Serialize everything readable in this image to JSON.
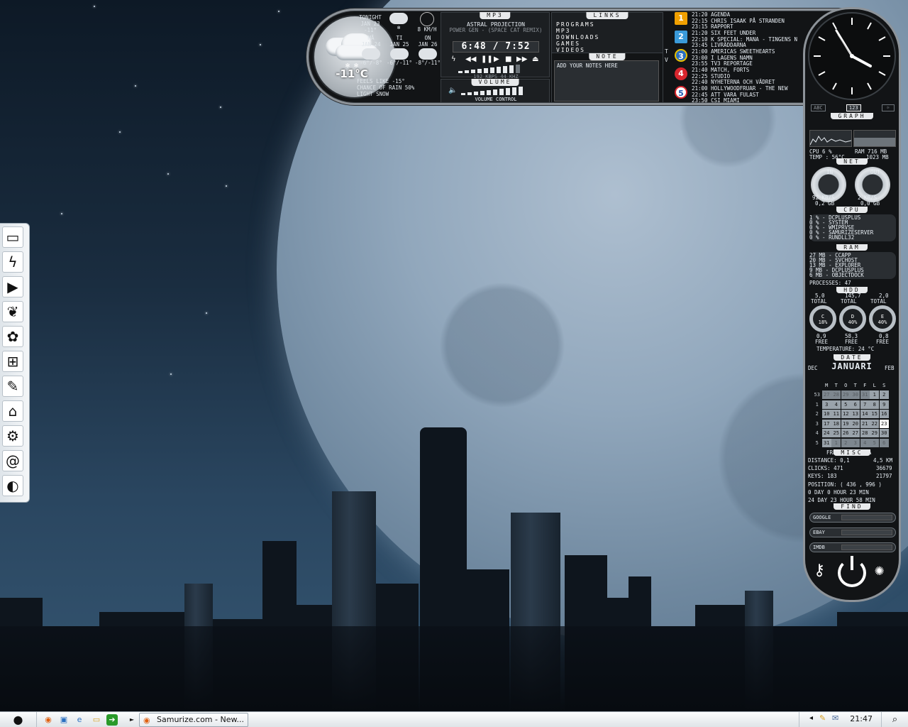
{
  "weather": {
    "current_temp": "-11°C",
    "tonight": {
      "label": "TONIGHT",
      "date": "JAN 23",
      "temp": "-11°"
    },
    "wind": "8 KM/H",
    "forecast": [
      {
        "day": "MÅ",
        "date": "JAN 24",
        "range": "-6°/-8°"
      },
      {
        "day": "TI",
        "date": "JAN 25",
        "range": "-6°/-11°"
      },
      {
        "day": "ON",
        "date": "JAN 26",
        "range": "-8°/-11°"
      }
    ],
    "feels_like": "FEELS LIKE -15°",
    "chance_rain": "CHANCE OF RAIN 50%",
    "condition": "LIGHT SNOW"
  },
  "mp3": {
    "title": "MP3",
    "artist": "ASTRAL PROJECTION",
    "track": "POWER GEN - (SPACE CAT REMIX)",
    "time": "6:48 / 7:52",
    "bitrate": "192 KBPS 44 KHZ",
    "volume_title": "VOLUME",
    "volume_label": "VOLUME CONTROL"
  },
  "links": {
    "title": "LINKS",
    "items": [
      "PROGRAMS",
      "MP3",
      "DOWNLOADS",
      "GAMES",
      "VIDEOS"
    ]
  },
  "note": {
    "title": "NOTE",
    "placeholder": "ADD YOUR NOTES HERE"
  },
  "tv": {
    "side_label": "T V",
    "channels": [
      {
        "num": "1",
        "lines": [
          "21:20 AGENDA",
          "22:15 CHRIS ISAAK PÅ STRANDEN",
          "23:15 RAPPORT"
        ],
        "color": "#f0a000"
      },
      {
        "num": "2",
        "lines": [
          "21:20 SIX FEET UNDER",
          "22:10 K SPECIAL: MANA - TINGENS N",
          "23:45 LIVRÄDDARNA"
        ],
        "color": "#3a9ad9"
      },
      {
        "num": "3",
        "lines": [
          "21:00 AMERICAS SWEETHEARTS",
          "23:00 I LAGENS NAMN",
          "23:55 TV3 REPORTAGE"
        ],
        "color": "#2a6fc0"
      },
      {
        "num": "4",
        "lines": [
          "21:40 MATCH, FORTS",
          "22:25 STUDIO",
          "22:40 NYHETERNA OCH VÄDRET"
        ],
        "color": "#d8262e"
      },
      {
        "num": "5",
        "lines": [
          "21:00 HOLLYWOODFRUAR - THE NEW",
          "22:45 ATT VARA FULAST",
          "23:50 CSI MIAMI"
        ],
        "color": "#1e5ab4"
      }
    ]
  },
  "clock": {
    "tabs": [
      "ABC",
      "123",
      "☼"
    ]
  },
  "graph": {
    "title": "GRAPH",
    "cpu": "CPU 6 %",
    "ram": "RAM 716 MB",
    "temp": "TEMP : 56°C",
    "ram2": "1023 MB"
  },
  "net": {
    "title": "NET",
    "in_label": "IN",
    "out_label": "OUT",
    "in_speed": "92 KB/S",
    "in_total": "0,2 GB",
    "out_speed": "2 KB/S",
    "out_total": "0,0 GB"
  },
  "cpu": {
    "title": "CPU",
    "processes": [
      "1 % - DCPLUSPLUS",
      "0 % - SYSTEM",
      "0 % - WMIPRVSE",
      "0 % - SAMURIZESERVER",
      "0 % - RUNDLL32"
    ]
  },
  "ram": {
    "title": "RAM",
    "processes": [
      "27 MB - CCAPP",
      "20 MB - SVCHOST",
      "13 MB - EXPLORER",
      "9 MB - DCPLUSPLUS",
      "6 MB - OBJECTDOCK"
    ],
    "count": "PROCESSES: 47"
  },
  "hdd": {
    "title": "HDD",
    "drives": [
      {
        "total": "5,0",
        "letter": "C",
        "pct": "18%",
        "free": "0,9"
      },
      {
        "total": "145,7",
        "letter": "D",
        "pct": "40%",
        "free": "58,3"
      },
      {
        "total": "2,0",
        "letter": "E",
        "pct": "40%",
        "free": "0,8"
      }
    ],
    "total_label": "TOTAL",
    "free_label": "FREE",
    "temperature": "TEMPERATURE: 24 °C"
  },
  "date": {
    "title": "DATE",
    "prev": "DEC",
    "month": "JANUARI",
    "next": "FEB",
    "weekdays": [
      "M",
      "T",
      "O",
      "T",
      "F",
      "L",
      "S"
    ],
    "weeks": [
      {
        "wk": "53",
        "days": [
          "27",
          "28",
          "29",
          "30",
          "31",
          "1",
          "2"
        ],
        "dim": [
          1,
          1,
          1,
          1,
          1,
          0,
          0
        ]
      },
      {
        "wk": "1",
        "days": [
          "3",
          "4",
          "5",
          "6",
          "7",
          "8",
          "9"
        ],
        "dim": [
          0,
          0,
          0,
          0,
          0,
          0,
          0
        ]
      },
      {
        "wk": "2",
        "days": [
          "10",
          "11",
          "12",
          "13",
          "14",
          "15",
          "16"
        ],
        "dim": [
          0,
          0,
          0,
          0,
          0,
          0,
          0
        ]
      },
      {
        "wk": "3",
        "days": [
          "17",
          "18",
          "19",
          "20",
          "21",
          "22",
          "23"
        ],
        "dim": [
          0,
          0,
          0,
          0,
          0,
          0,
          0
        ]
      },
      {
        "wk": "4",
        "days": [
          "24",
          "25",
          "26",
          "27",
          "28",
          "29",
          "30"
        ],
        "dim": [
          0,
          0,
          0,
          0,
          0,
          0,
          0
        ]
      },
      {
        "wk": "5",
        "days": [
          "31",
          "1",
          "2",
          "3",
          "4",
          "5",
          "6"
        ],
        "dim": [
          0,
          1,
          1,
          1,
          1,
          1,
          1
        ]
      }
    ],
    "today": "23",
    "nameday": "FREJ OCH FREJA"
  },
  "misc": {
    "title": "MISC",
    "distance": "DISTANCE: 0,1",
    "distance_total": "4,5 KM",
    "clicks": "CLICKS: 471",
    "clicks_total": "36679",
    "keys": "KEYS: 183",
    "keys_total": "21797",
    "position": "POSITION: ( 436 , 996 )",
    "uptime1": "0 DAY 0 HOUR 23 MIN",
    "uptime2": "24 DAY 23 HOUR 58 MIN"
  },
  "find": {
    "title": "FIND",
    "engines": [
      "GOOGLE",
      "EBAY",
      "IMDB"
    ]
  },
  "taskbar": {
    "task_label": "Samurize.com - New...",
    "clock": "21:47",
    "quicklaunch": [
      "firefox-icon",
      "network-icon",
      "ie-icon",
      "folder-icon",
      "exit-icon"
    ]
  }
}
